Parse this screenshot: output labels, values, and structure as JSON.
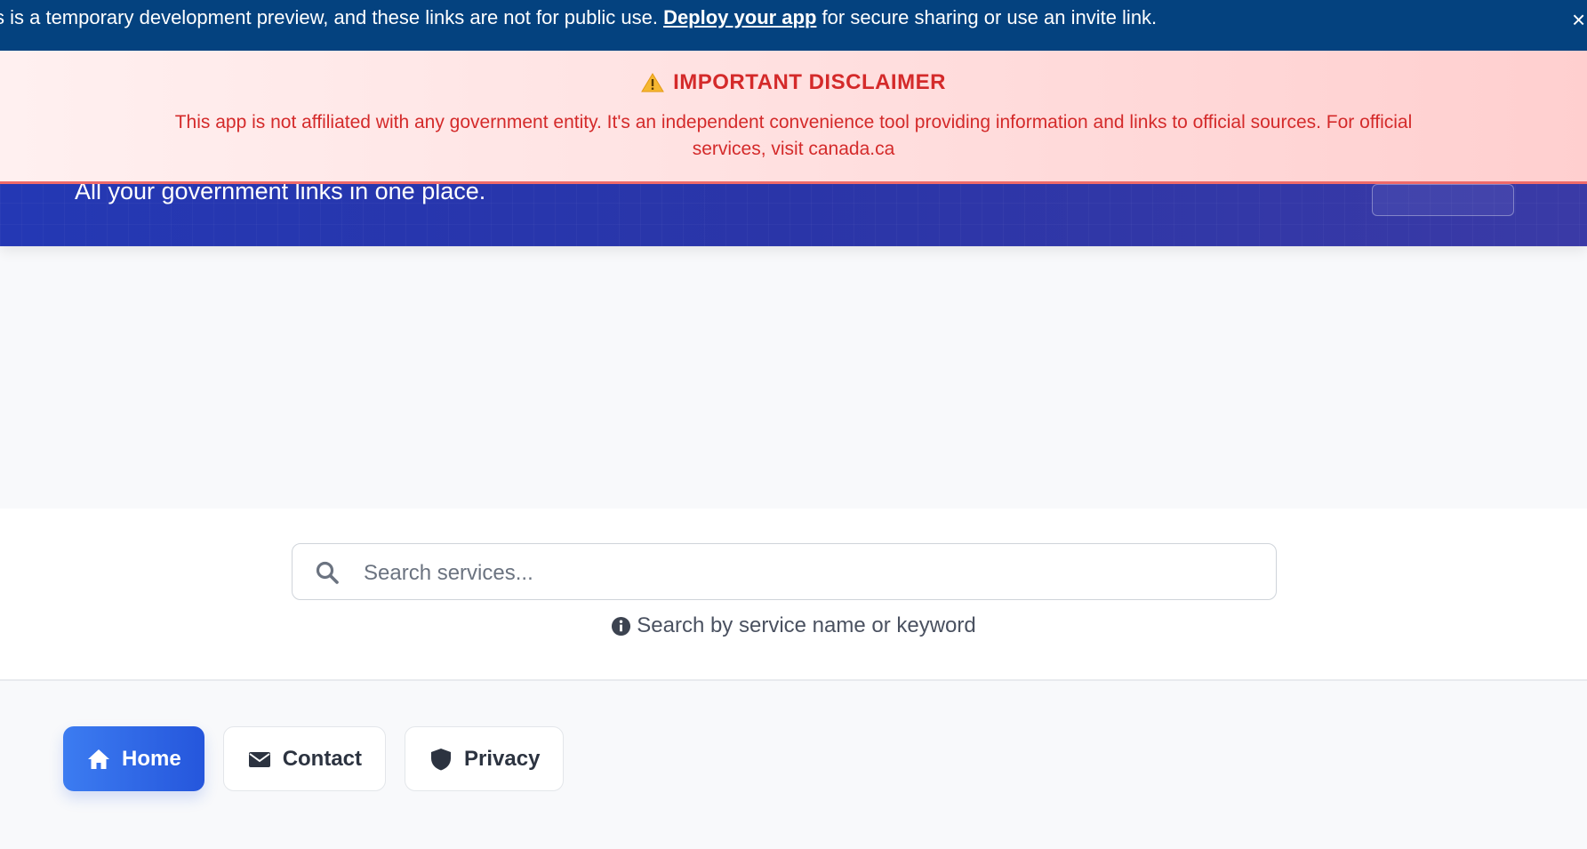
{
  "preview_banner": {
    "text_before": "s is a temporary development preview, and these links are not for public use. ",
    "link": "Deploy your app",
    "text_after": " for secure sharing or use an invite link.",
    "close_glyph": "×"
  },
  "hero": {
    "subtitle": "All your government links in one place."
  },
  "disclaimer": {
    "icon": "warning-icon",
    "title": "IMPORTANT DISCLAIMER",
    "body": "This app is not affiliated with any government entity. It's an independent convenience tool providing information and links to official sources. For official services, visit canada.ca"
  },
  "search": {
    "placeholder": "Search services...",
    "hint": "Search by service name or keyword"
  },
  "nav": {
    "items": [
      {
        "label": "Home",
        "icon": "home-icon",
        "active": true
      },
      {
        "label": "Contact",
        "icon": "envelope-icon",
        "active": false
      },
      {
        "label": "Privacy",
        "icon": "shield-icon",
        "active": false
      }
    ]
  },
  "colors": {
    "preview_banner": "#04427f",
    "hero": "#2a35a8",
    "disclaimer_text": "#d42a2a",
    "active_nav": "#2556dc"
  }
}
